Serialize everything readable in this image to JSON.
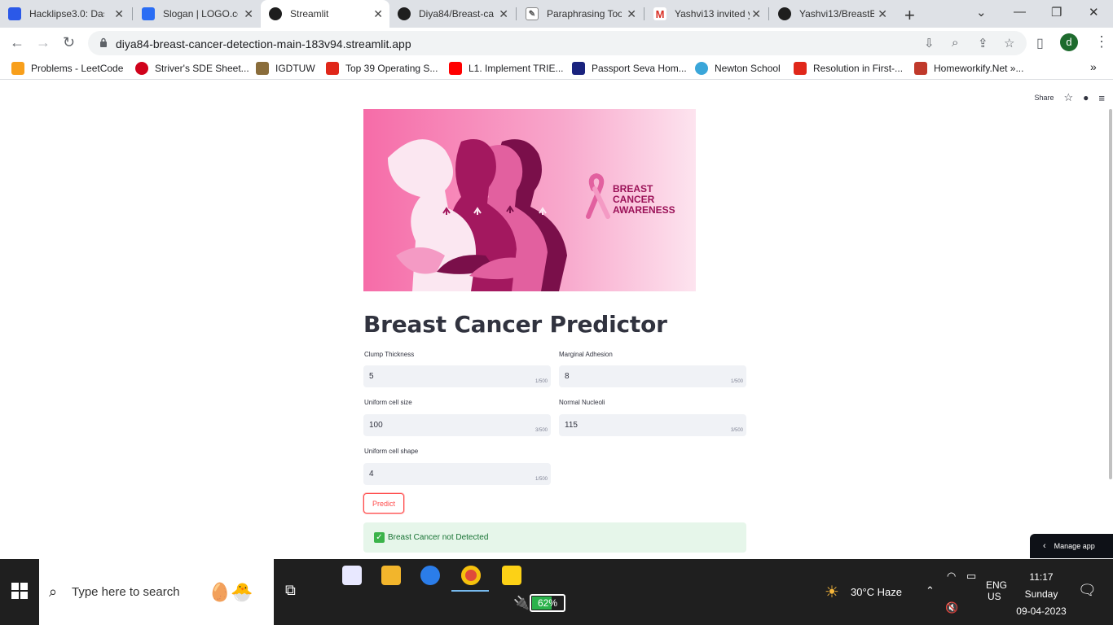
{
  "browser": {
    "tabs": [
      {
        "title": "Hacklipse3.0: Das",
        "color": "#2b59e8"
      },
      {
        "title": "Slogan | LOGO.co",
        "color": "#2a6df4"
      },
      {
        "title": "Streamlit",
        "color": "#1e1e1e"
      },
      {
        "title": "Diya84/Breast-ca",
        "color": "#1e1e1e"
      },
      {
        "title": "Paraphrasing Too",
        "color": "#666666"
      },
      {
        "title": "Yashvi13 invited y",
        "color": "#d93025"
      },
      {
        "title": "Yashvi13/BreastB",
        "color": "#1e1e1e"
      }
    ],
    "new_tab": "+",
    "url": "diya84-breast-cancer-detection-main-183v94.streamlit.app",
    "profile_letter": "d",
    "bookmarks": [
      {
        "label": "Problems - LeetCode",
        "color": "#f89f1b"
      },
      {
        "label": "Striver's SDE Sheet...",
        "color": "#d0021b"
      },
      {
        "label": "IGDTUW",
        "color": "#8a6d3b"
      },
      {
        "label": "Top 39 Operating S...",
        "color": "#e0271a"
      },
      {
        "label": "L1. Implement TRIE...",
        "color": "#ff0000"
      },
      {
        "label": "Passport Seva Hom...",
        "color": "#1a237e"
      },
      {
        "label": "Newton School",
        "color": "#3aa6d9"
      },
      {
        "label": "Resolution in First-...",
        "color": "#e0271a"
      },
      {
        "label": "Homeworkify.Net »...",
        "color": "#c0392b"
      }
    ]
  },
  "app": {
    "header": {
      "share": "Share"
    },
    "hero": {
      "line1": "BREAST",
      "line2": "CANCER",
      "line3": "AWARENESS"
    },
    "title": "Breast Cancer Predictor",
    "fields": {
      "clump": {
        "label": "Clump Thickness",
        "value": "5",
        "count": "1/500"
      },
      "adhesion": {
        "label": "Marginal Adhesion",
        "value": "8",
        "count": "1/500"
      },
      "cell_size": {
        "label": "Uniform cell size",
        "value": "100",
        "count": "3/500"
      },
      "nucleoli": {
        "label": "Normal Nucleoli",
        "value": "115",
        "count": "3/500"
      },
      "cell_shape": {
        "label": "Uniform cell shape",
        "value": "4",
        "count": "1/500"
      }
    },
    "predict_label": "Predict",
    "result": "Breast Cancer not Detected",
    "manage_app": "Manage app"
  },
  "taskbar": {
    "search_placeholder": "Type here to search",
    "battery": "62%",
    "battery_level": 0.62,
    "weather": "30°C  Haze",
    "lang1": "ENG",
    "lang2": "US",
    "time": "11:17",
    "day": "Sunday",
    "date": "09-04-2023"
  }
}
